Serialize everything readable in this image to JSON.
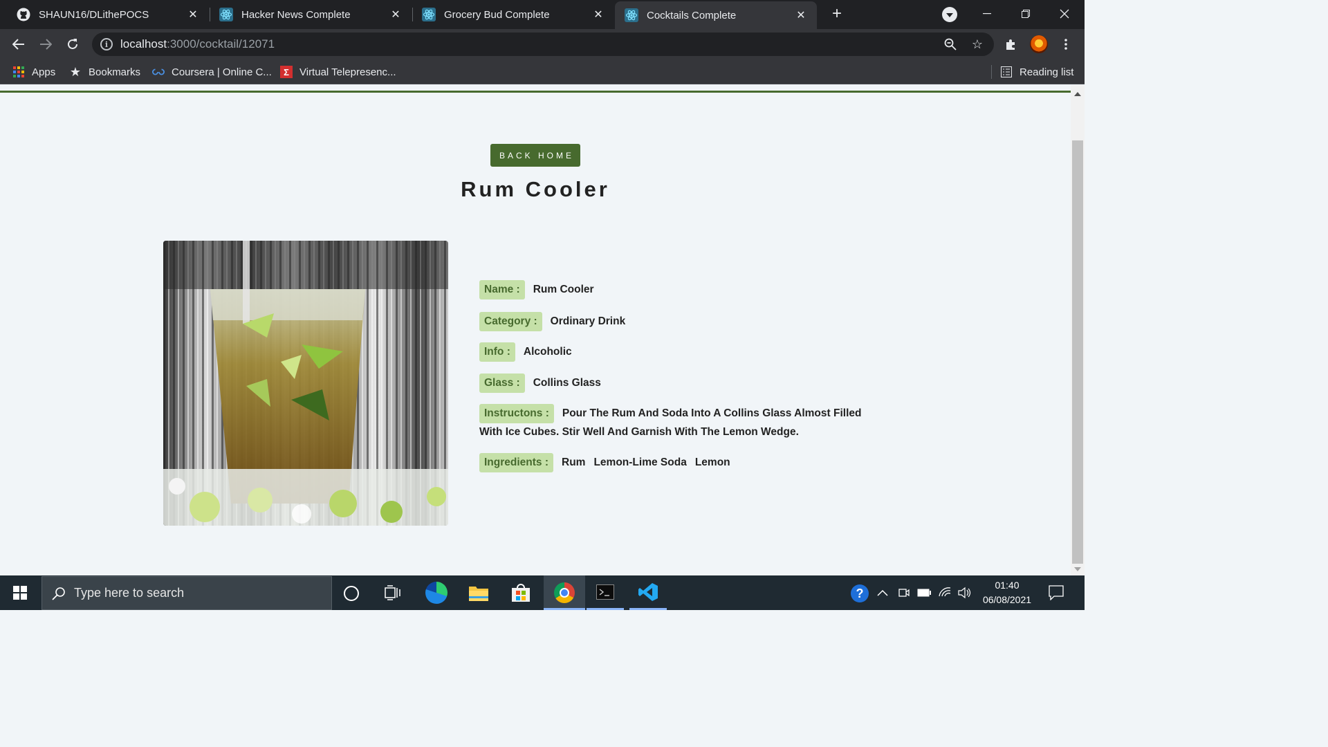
{
  "tabs": [
    {
      "title": "SHAUN16/DLithePOCS",
      "icon": "github-icon"
    },
    {
      "title": "Hacker News Complete",
      "icon": "react-icon"
    },
    {
      "title": "Grocery Bud Complete",
      "icon": "react-icon"
    },
    {
      "title": "Cocktails Complete",
      "icon": "react-icon",
      "active": true
    }
  ],
  "address": {
    "host": "localhost",
    "path": ":3000/cocktail/12071"
  },
  "bookmarks": {
    "apps": "Apps",
    "bookmarks": "Bookmarks",
    "coursera": "Coursera | Online C...",
    "virtual": "Virtual Telepresenc...",
    "reading_list": "Reading list"
  },
  "page": {
    "back_home": "BACK HOME",
    "title": "Rum Cooler",
    "fields": {
      "name_label": "Name :",
      "name": "Rum Cooler",
      "category_label": "Category :",
      "category": "Ordinary Drink",
      "info_label": "Info :",
      "info": "Alcoholic",
      "glass_label": "Glass :",
      "glass": "Collins Glass",
      "instructions_label": "Instructons :",
      "instructions": "Pour The Rum And Soda Into A Collins Glass Almost Filled With Ice Cubes. Stir Well And Garnish With The Lemon Wedge.",
      "ingredients_label": "Ingredients :",
      "ingredients": [
        "Rum",
        "Lemon-Lime Soda",
        "Lemon"
      ]
    }
  },
  "taskbar": {
    "search_placeholder": "Type here to search",
    "time": "01:40",
    "date": "06/08/2021"
  },
  "colors": {
    "accent": "#476a2e",
    "label_bg": "#c5e0a8",
    "page_bg": "#f1f5f8"
  }
}
